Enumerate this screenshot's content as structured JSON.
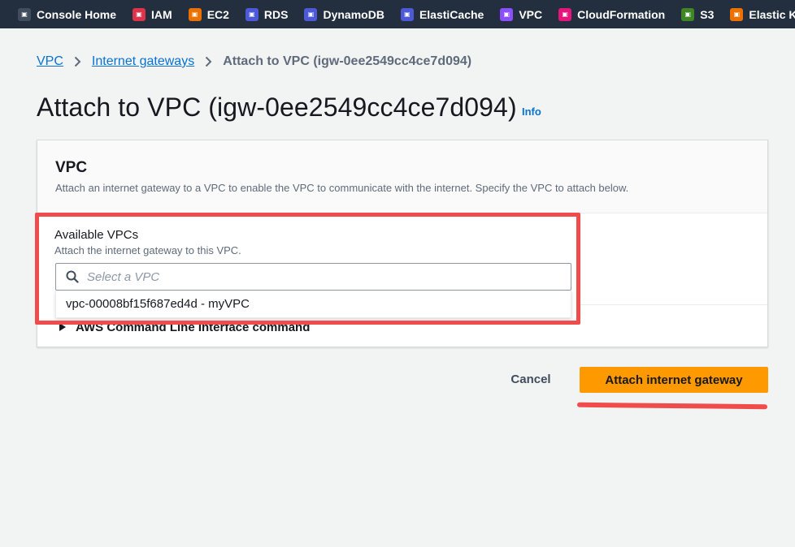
{
  "topnav": {
    "items": [
      {
        "label": "Console Home",
        "icon": "console-home-icon",
        "color": "#414d5c"
      },
      {
        "label": "IAM",
        "icon": "iam-icon",
        "color": "#dd344c"
      },
      {
        "label": "EC2",
        "icon": "ec2-icon",
        "color": "#ed7100"
      },
      {
        "label": "RDS",
        "icon": "rds-icon",
        "color": "#4d5ad7"
      },
      {
        "label": "DynamoDB",
        "icon": "dynamodb-icon",
        "color": "#4d5ad7"
      },
      {
        "label": "ElastiCache",
        "icon": "elasticache-icon",
        "color": "#4d5ad7"
      },
      {
        "label": "VPC",
        "icon": "vpc-icon",
        "color": "#8c4fff"
      },
      {
        "label": "CloudFormation",
        "icon": "cloudformation-icon",
        "color": "#e7157b"
      },
      {
        "label": "S3",
        "icon": "s3-icon",
        "color": "#3f8624"
      },
      {
        "label": "Elastic Kubernetes",
        "icon": "eks-icon",
        "color": "#ed7100"
      }
    ]
  },
  "breadcrumb": {
    "vpc": "VPC",
    "internet_gateways": "Internet gateways",
    "current": "Attach to VPC (igw-0ee2549cc4ce7d094)"
  },
  "page": {
    "title": "Attach to VPC (igw-0ee2549cc4ce7d094)",
    "info": "Info"
  },
  "container": {
    "title": "VPC",
    "description": "Attach an internet gateway to a VPC to enable the VPC to communicate with the internet. Specify the VPC to attach below.",
    "expand_label": "AWS Command Line Interface command"
  },
  "vpc_field": {
    "label": "Available VPCs",
    "description": "Attach the internet gateway to this VPC.",
    "placeholder": "Select a VPC",
    "option": "vpc-00008bf15f687ed4d - myVPC"
  },
  "actions": {
    "cancel": "Cancel",
    "attach": "Attach internet gateway"
  },
  "colors": {
    "nav_bg": "#232f3e",
    "link": "#0972d3",
    "primary": "#ff9900",
    "annotation": "#f14c4c"
  }
}
